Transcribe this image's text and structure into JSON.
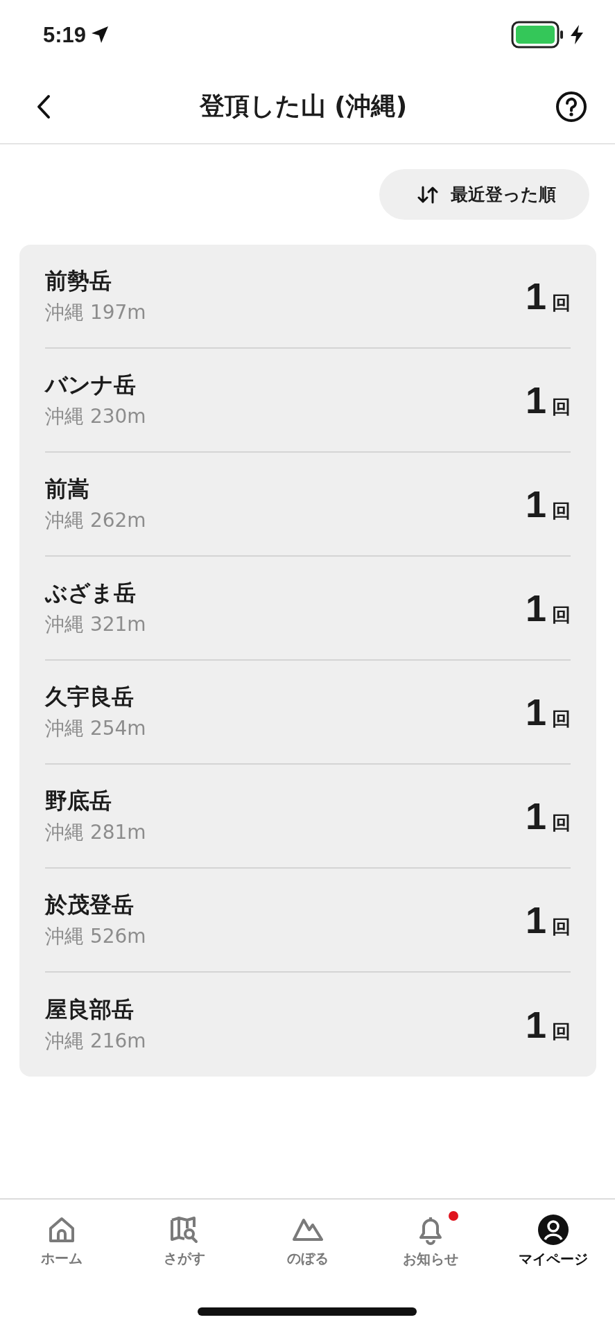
{
  "status_bar": {
    "time": "5:19",
    "charging": true
  },
  "nav": {
    "title": "登頂した山 (沖縄)"
  },
  "sort_button": {
    "label": "最近登った順"
  },
  "mountains": [
    {
      "name": "前勢岳",
      "detail": "沖縄 197m",
      "count": "1",
      "unit": "回"
    },
    {
      "name": "バンナ岳",
      "detail": "沖縄 230m",
      "count": "1",
      "unit": "回"
    },
    {
      "name": "前嵩",
      "detail": "沖縄 262m",
      "count": "1",
      "unit": "回"
    },
    {
      "name": "ぶざま岳",
      "detail": "沖縄 321m",
      "count": "1",
      "unit": "回"
    },
    {
      "name": "久宇良岳",
      "detail": "沖縄 254m",
      "count": "1",
      "unit": "回"
    },
    {
      "name": "野底岳",
      "detail": "沖縄 281m",
      "count": "1",
      "unit": "回"
    },
    {
      "name": "於茂登岳",
      "detail": "沖縄 526m",
      "count": "1",
      "unit": "回"
    },
    {
      "name": "屋良部岳",
      "detail": "沖縄 216m",
      "count": "1",
      "unit": "回"
    }
  ],
  "tab_bar": [
    {
      "kind": "home",
      "label": "ホーム",
      "selected": false,
      "badge": false
    },
    {
      "kind": "map",
      "label": "さがす",
      "selected": false,
      "badge": false
    },
    {
      "kind": "mountain",
      "label": "のぼる",
      "selected": false,
      "badge": false
    },
    {
      "kind": "bell",
      "label": "お知らせ",
      "selected": false,
      "badge": true
    },
    {
      "kind": "person",
      "label": "マイページ",
      "selected": true,
      "badge": false
    }
  ]
}
